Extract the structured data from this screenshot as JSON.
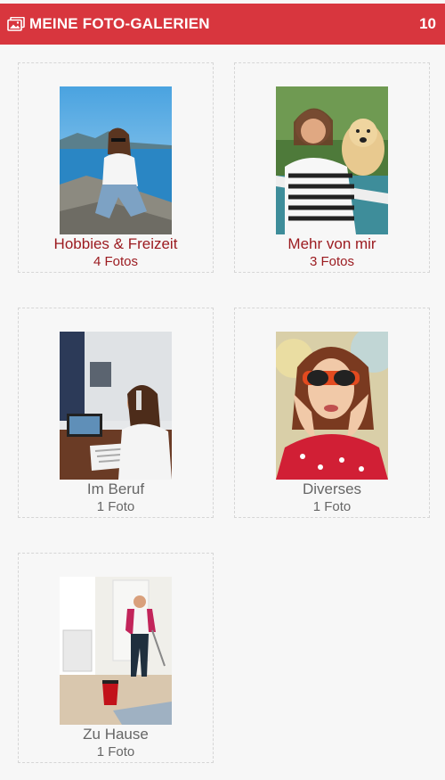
{
  "header": {
    "title": "MEINE FOTO-GALERIEN",
    "count": "10",
    "icon": "gallery-icon"
  },
  "galleries": [
    {
      "name": "Hobbies & Freizeit",
      "count": "4 Fotos",
      "state": "active"
    },
    {
      "name": "Mehr von mir",
      "count": "3 Fotos",
      "state": "active"
    },
    {
      "name": "Im Beruf",
      "count": "1 Foto",
      "state": "inactive"
    },
    {
      "name": "Diverses",
      "count": "1 Foto",
      "state": "inactive"
    },
    {
      "name": "Zu Hause",
      "count": "1 Foto",
      "state": "inactive"
    }
  ],
  "colors": {
    "header_bg": "#d8363e",
    "active_text": "#9b1a1f",
    "inactive_text": "#666666"
  }
}
